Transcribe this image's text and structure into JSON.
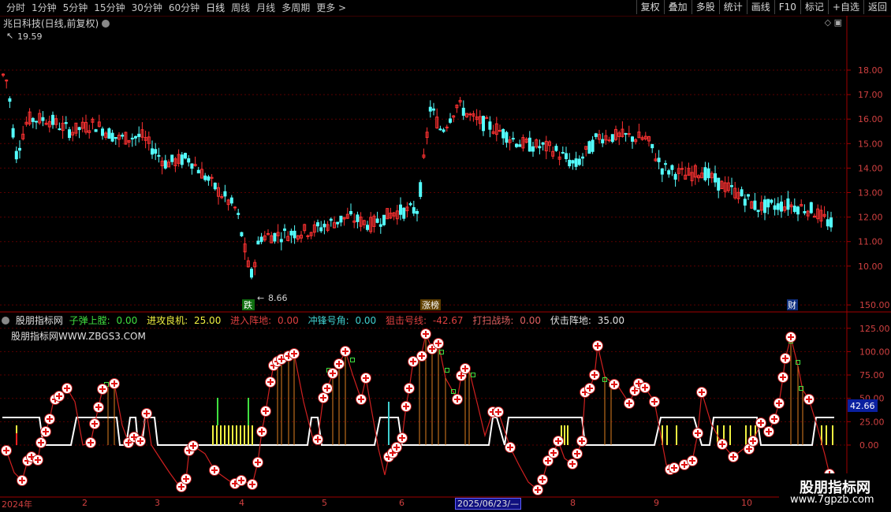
{
  "toolbar": {
    "periods": [
      "分时",
      "1分钟",
      "5分钟",
      "15分钟",
      "30分钟",
      "60分钟",
      "日线",
      "周线",
      "月线",
      "多周期",
      "更多 >"
    ],
    "actions": [
      "复权",
      "叠加",
      "多股",
      "统计",
      "画线",
      "F10",
      "标记",
      "+自选",
      "返回"
    ]
  },
  "main_chart": {
    "title": "兆日科技(日线,前复权)",
    "high_label": "19.59",
    "low_label": "8.66",
    "price_ticks": [
      "18.00",
      "17.00",
      "16.00",
      "15.00",
      "14.00",
      "13.00",
      "12.00",
      "11.00",
      "10.00"
    ],
    "badges": [
      "跌",
      "涨榜",
      "财"
    ]
  },
  "indicator": {
    "name": "股朋指标网",
    "items": [
      {
        "label": "子弹上膛:",
        "value": "0.00",
        "color": "#40e040"
      },
      {
        "label": "进攻良机:",
        "value": "25.00",
        "color": "#f0f040"
      },
      {
        "label": "进入阵地:",
        "value": "0.00",
        "color": "#e04040"
      },
      {
        "label": "冲锋号角:",
        "value": "0.00",
        "color": "#40d0d0"
      },
      {
        "label": "狙击号线:",
        "value": "-42.67",
        "color": "#e04040"
      },
      {
        "label": "打扫战场:",
        "value": "0.00",
        "color": "#e06060"
      },
      {
        "label": "伏击阵地:",
        "value": "35.00",
        "color": "#e0e0e0"
      }
    ],
    "watermark": "股朋指标网WWW.ZBGS3.COM",
    "ticks": [
      "150.00",
      "125.00",
      "100.00",
      "75.00",
      "50.00",
      "25.00",
      "0.00"
    ],
    "current_value": "42.66"
  },
  "timeline": {
    "labels": [
      "2024年",
      "2",
      "3",
      "4",
      "5",
      "6",
      "7",
      "8",
      "9",
      "10"
    ],
    "cursor": "2025/06/23/—"
  },
  "brand_watermark": {
    "name": "股朋指标网",
    "url": "www.7gpzb.com"
  },
  "colors": {
    "up": "#ff3232",
    "down": "#54ffff",
    "grid": "#5a0000",
    "axis": "#a00000"
  }
}
